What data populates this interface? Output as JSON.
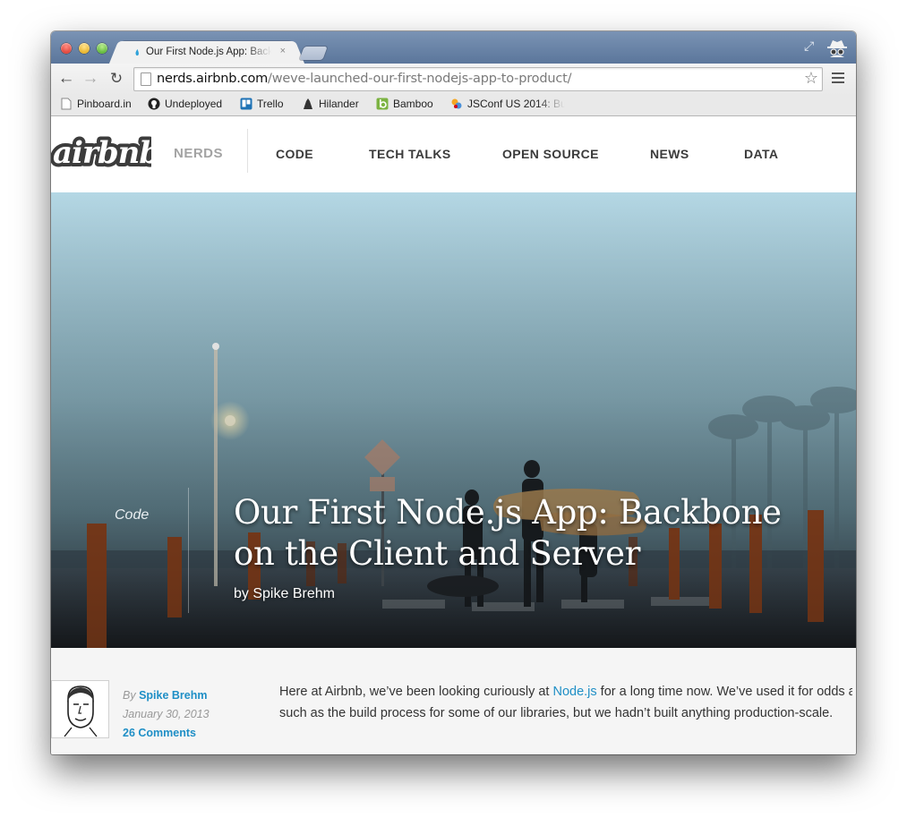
{
  "browser": {
    "tab": {
      "title": "Our First Node.js App: Backbone on the Client and Server",
      "close": "×"
    },
    "url": {
      "host": "nerds.airbnb.com",
      "path": "/weve-launched-our-first-nodejs-app-to-product/"
    },
    "bookmarks": [
      {
        "label": "Pinboard.in",
        "icon": "page-icon"
      },
      {
        "label": "Undeployed",
        "icon": "github-icon"
      },
      {
        "label": "Trello",
        "icon": "trello-icon"
      },
      {
        "label": "Hilander",
        "icon": "hilander-icon"
      },
      {
        "label": "Bamboo",
        "icon": "bamboo-icon"
      },
      {
        "label": "JSConf US 2014: Buil",
        "icon": "jsconf-icon"
      }
    ]
  },
  "site": {
    "logo_text": "airbnb",
    "section": "NERDS",
    "nav": [
      "CODE",
      "TECH TALKS",
      "OPEN SOURCE",
      "NEWS",
      "DATA"
    ]
  },
  "hero": {
    "category": "Code",
    "title_line1": "Our First Node.js App: Backbone",
    "title_line2": "on the Client and Server",
    "byline": "by Spike Brehm"
  },
  "article": {
    "by": "By",
    "author": "Spike Brehm",
    "date": "January 30, 2013",
    "comments": "26 Comments",
    "line1_before": "Here at Airbnb, we’ve been looking curiously at ",
    "line1_link": "Node.js",
    "line1_after": " for a long time now.  We’ve used it for odds and ends,",
    "line2": "such as the build process for some of our libraries, but we hadn’t built anything production-scale."
  },
  "colors": {
    "link": "#1f8fc6",
    "nav_text": "#3b3b3b",
    "titlebar": "#6a84a8"
  }
}
